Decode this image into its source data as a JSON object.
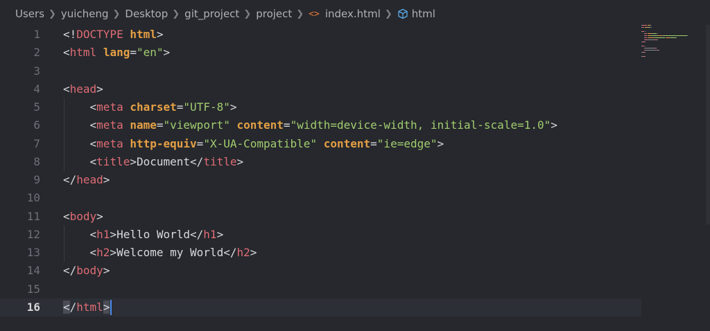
{
  "breadcrumb": {
    "items": [
      "Users",
      "yuicheng",
      "Desktop",
      "git_project",
      "project",
      "index.html",
      "html"
    ],
    "file_icon": "code-file-icon",
    "element_icon": "symbol-element-icon",
    "separator_icon": "chevron-right-icon"
  },
  "editor": {
    "active_line": 16,
    "line_numbers": [
      "1",
      "2",
      "3",
      "4",
      "5",
      "6",
      "7",
      "8",
      "9",
      "10",
      "11",
      "12",
      "13",
      "14",
      "15",
      "16"
    ],
    "lines": [
      [
        [
          "p",
          "<!"
        ],
        [
          "t",
          "DOCTYPE"
        ],
        [
          "p",
          " "
        ],
        [
          "a",
          "html"
        ],
        [
          "p",
          ">"
        ]
      ],
      [
        [
          "p",
          "<"
        ],
        [
          "t",
          "html"
        ],
        [
          "p",
          " "
        ],
        [
          "a",
          "lang"
        ],
        [
          "p",
          "="
        ],
        [
          "s",
          "\"en\""
        ],
        [
          "p",
          ">"
        ]
      ],
      [],
      [
        [
          "p",
          "<"
        ],
        [
          "t",
          "head"
        ],
        [
          "p",
          ">"
        ]
      ],
      [
        [
          "p",
          "    <"
        ],
        [
          "t",
          "meta"
        ],
        [
          "p",
          " "
        ],
        [
          "a",
          "charset"
        ],
        [
          "p",
          "="
        ],
        [
          "s",
          "\"UTF-8\""
        ],
        [
          "p",
          ">"
        ]
      ],
      [
        [
          "p",
          "    <"
        ],
        [
          "t",
          "meta"
        ],
        [
          "p",
          " "
        ],
        [
          "a",
          "name"
        ],
        [
          "p",
          "="
        ],
        [
          "s",
          "\"viewport\""
        ],
        [
          "p",
          " "
        ],
        [
          "a",
          "content"
        ],
        [
          "p",
          "="
        ],
        [
          "s",
          "\"width=device-width, initial-scale=1.0\""
        ],
        [
          "p",
          ">"
        ]
      ],
      [
        [
          "p",
          "    <"
        ],
        [
          "t",
          "meta"
        ],
        [
          "p",
          " "
        ],
        [
          "a",
          "http-equiv"
        ],
        [
          "p",
          "="
        ],
        [
          "s",
          "\"X-UA-Compatible\""
        ],
        [
          "p",
          " "
        ],
        [
          "a",
          "content"
        ],
        [
          "p",
          "="
        ],
        [
          "s",
          "\"ie=edge\""
        ],
        [
          "p",
          ">"
        ]
      ],
      [
        [
          "p",
          "    <"
        ],
        [
          "t",
          "title"
        ],
        [
          "p",
          ">Document</"
        ],
        [
          "t",
          "title"
        ],
        [
          "p",
          ">"
        ]
      ],
      [
        [
          "p",
          "</"
        ],
        [
          "t",
          "head"
        ],
        [
          "p",
          ">"
        ]
      ],
      [],
      [
        [
          "p",
          "<"
        ],
        [
          "t",
          "body"
        ],
        [
          "p",
          ">"
        ]
      ],
      [
        [
          "p",
          "    <"
        ],
        [
          "t",
          "h1"
        ],
        [
          "p",
          ">Hello World</"
        ],
        [
          "t",
          "h1"
        ],
        [
          "p",
          ">"
        ]
      ],
      [
        [
          "p",
          "    <"
        ],
        [
          "t",
          "h2"
        ],
        [
          "p",
          ">Welcome my World</"
        ],
        [
          "t",
          "h2"
        ],
        [
          "p",
          ">"
        ]
      ],
      [
        [
          "p",
          "</"
        ],
        [
          "t",
          "body"
        ],
        [
          "p",
          ">"
        ]
      ],
      [],
      [
        [
          "hb",
          "<"
        ],
        [
          "p",
          "/"
        ],
        [
          "t",
          "html"
        ],
        [
          "hb",
          ">"
        ]
      ]
    ]
  },
  "colors": {
    "background": "#26282d",
    "tag": "#e06c75",
    "attribute": "#e5a045",
    "string": "#a2cd6f",
    "text": "#d7d9dd",
    "cursor": "#4d8cf0"
  }
}
